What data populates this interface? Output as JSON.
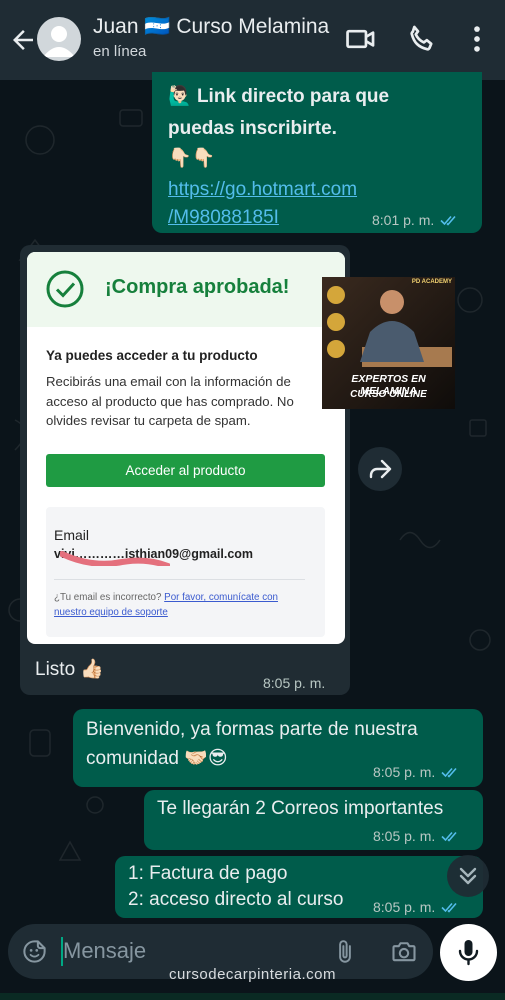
{
  "header": {
    "contact_name": "Juan 🇭🇳 Curso Melamina",
    "status": "en línea"
  },
  "messages": {
    "m1": {
      "emoji": "🙋🏻‍♂️",
      "text_line1": "Link directo para que",
      "text_line2": "puedas inscribirte.",
      "pointing": "👇🏻👇🏻",
      "link_line1": "https://go.hotmart.com",
      "link_line2": "/M98088185I",
      "time": "8:01 p. m."
    },
    "m2": {
      "receipt": {
        "title": "¡Compra aprobada!",
        "heading": "Ya puedes acceder a tu producto",
        "body": "Recibirás una email con la información de acceso al producto que has comprado. No olvides revisar tu carpeta de spam.",
        "button": "Acceder al producto",
        "email_label": "Email",
        "email_value": "vivi…………isthian09@gmail.com",
        "help_text": "¿Tu email es incorrecto? ",
        "help_link": "Por favor, comunícate con nuestro equipo de soporte"
      },
      "course_image": {
        "badge": "PD ACADEMY",
        "title": "EXPERTOS EN MELAMINA",
        "subtitle": "CURSO ONLINE"
      },
      "caption": "Listo 👍🏻",
      "time": "8:05 p. m."
    },
    "m3": {
      "line1": "Bienvenido, ya formas parte de nuestra",
      "line2": "comunidad 🤝🏻😎",
      "time": "8:05 p. m."
    },
    "m4": {
      "text": "Te llegarán 2 Correos importantes",
      "time": "8:05 p. m."
    },
    "m5": {
      "line1": "1: Factura de pago",
      "line2": "2: acceso directo al curso",
      "time": "8:05 p. m."
    }
  },
  "composer": {
    "placeholder": "Mensaje"
  },
  "watermark": "cursodecarpinteria.com",
  "colors": {
    "outgoing_bubble": "#005c4b",
    "incoming_bubble": "#202c33",
    "header": "#1f2c34",
    "read_ticks": "#53bdeb",
    "accent": "#00a884"
  }
}
